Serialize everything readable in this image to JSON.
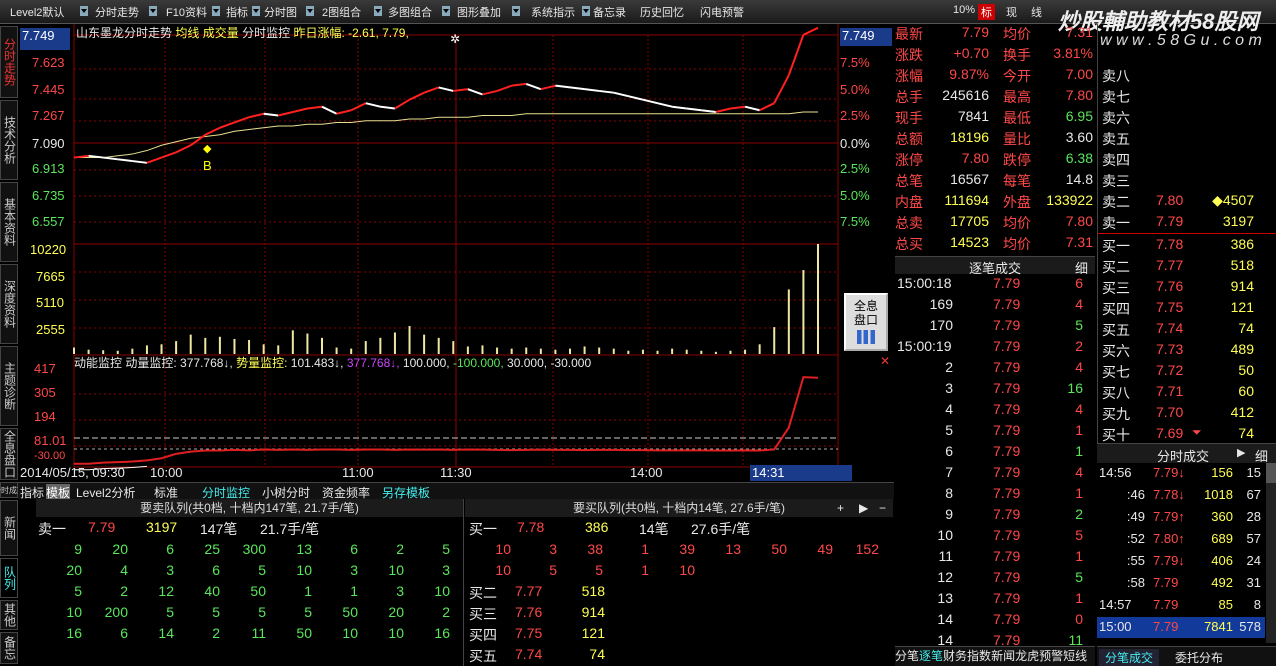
{
  "menu": [
    "Level2默认",
    "分时走势",
    "F10资料",
    "指标",
    "分时图",
    "2图组合",
    "多图组合",
    "图形叠加",
    "系统指示",
    "备忘录",
    "历史回忆",
    "闪电预警"
  ],
  "menu_right": {
    "pct": "10%",
    "biao": "标",
    "xian": "现",
    "line": "线"
  },
  "watermark": {
    "main": "炒股輔助教材58股网",
    "url": "w w w . 5 8 G u . c o m"
  },
  "sidetabs": [
    "分时走势",
    "技术分析",
    "基本资料",
    "深度资料",
    "主题诊断",
    "全息盘口"
  ],
  "sidetabs2": [
    "分时成交",
    "队列",
    "其他",
    "备忘"
  ],
  "news_tab": "新闻",
  "chart_header": {
    "name": "山东墨龙分时走势",
    "ma": "均线",
    "vol": "成交量",
    "monitor": "分时监控",
    "prev": "昨日涨幅: -2.61, 7.79,"
  },
  "price_axis": {
    "left": [
      "7.749",
      "7.623",
      "7.445",
      "7.267",
      "7.090",
      "6.913",
      "6.735",
      "6.557"
    ],
    "right": [
      "7.749",
      "7.5%",
      "5.0%",
      "2.5%",
      "0.0%",
      "2.5%",
      "5.0%",
      "7.5%"
    ]
  },
  "vol_axis": [
    "10220",
    "7665",
    "5110",
    "2555"
  ],
  "ind_axis": [
    "417",
    "305",
    "194",
    "81.01",
    "-30.00"
  ],
  "marker": "B",
  "quan": [
    "全息",
    "盘口"
  ],
  "ind_header": {
    "a": "动能监控",
    "b": "动量监控:",
    "c": "377.768↓,",
    "d": "势量监控:",
    "e": "101.483↓,",
    "f": "377.768↓,",
    "g": "100.000,",
    "h": "-100.000,",
    "i": "30.000,",
    "j": "-30.000"
  },
  "time_axis": {
    "date": "2014/05/15, 09:30",
    "t1": "10:00",
    "t2": "11:00",
    "t3": "11:30",
    "t4": "14:00",
    "t5": "14:31"
  },
  "bottom_tabs": [
    "指标",
    "模板",
    "Level2分析",
    "标准",
    "分时监控",
    "小树分时",
    "资金频率",
    "另存模板"
  ],
  "sell_queue": {
    "title": "要卖队列(共0档, 十档内147笔, 21.7手/笔)",
    "label": "卖一",
    "price": "7.79",
    "vol": "3197",
    "count": "147笔",
    "avg": "21.7手/笔",
    "rows": [
      [
        "9",
        "20",
        "6",
        "25",
        "300",
        "13",
        "6",
        "2",
        "5"
      ],
      [
        "20",
        "4",
        "3",
        "6",
        "5",
        "10",
        "3",
        "10",
        "3"
      ],
      [
        "5",
        "2",
        "12",
        "40",
        "50",
        "1",
        "1",
        "3",
        "10"
      ],
      [
        "10",
        "200",
        "5",
        "5",
        "5",
        "5",
        "50",
        "20",
        "2"
      ],
      [
        "16",
        "6",
        "14",
        "2",
        "11",
        "50",
        "10",
        "10",
        "16"
      ]
    ]
  },
  "buy_queue": {
    "title": "要买队列(共0档, 十档内14笔, 27.6手/笔)",
    "label": "买一",
    "price": "7.78",
    "vol": "386",
    "count": "14笔",
    "avg": "27.6手/笔",
    "rows": [
      [
        "10",
        "3",
        "38",
        "1",
        "39",
        "13",
        "50",
        "49",
        "152"
      ],
      [
        "10",
        "5",
        "5",
        "1",
        "10"
      ]
    ],
    "levels": [
      [
        "买二",
        "7.77",
        "518"
      ],
      [
        "买三",
        "7.76",
        "914"
      ],
      [
        "买四",
        "7.75",
        "121"
      ],
      [
        "买五",
        "7.74",
        "74"
      ]
    ]
  },
  "stats": [
    [
      "最新",
      "7.79",
      "均价",
      "7.31"
    ],
    [
      "涨跌",
      "+0.70",
      "换手",
      "3.81%"
    ],
    [
      "涨幅",
      "9.87%",
      "今开",
      "7.00"
    ],
    [
      "总手",
      "245616",
      "最高",
      "7.80"
    ],
    [
      "现手",
      "7841",
      "最低",
      "6.95"
    ],
    [
      "总额",
      "18196",
      "量比",
      "3.60"
    ],
    [
      "涨停",
      "7.80",
      "跌停",
      "6.38"
    ],
    [
      "总笔",
      "16567",
      "每笔",
      "14.8"
    ],
    [
      "内盘",
      "111694",
      "外盘",
      "133922"
    ],
    [
      "总卖",
      "17705",
      "均价",
      "7.80"
    ],
    [
      "总买",
      "14523",
      "均价",
      "7.31"
    ]
  ],
  "asks": [
    [
      "卖八",
      "",
      ""
    ],
    [
      "卖七",
      "",
      ""
    ],
    [
      "卖六",
      "",
      ""
    ],
    [
      "卖五",
      "",
      ""
    ],
    [
      "卖四",
      "",
      ""
    ],
    [
      "卖三",
      "",
      ""
    ],
    [
      "卖二",
      "7.80",
      "4507"
    ],
    [
      "卖一",
      "7.79",
      "3197"
    ]
  ],
  "bids": [
    [
      "买一",
      "7.78",
      "386"
    ],
    [
      "买二",
      "7.77",
      "518"
    ],
    [
      "买三",
      "7.76",
      "914"
    ],
    [
      "买四",
      "7.75",
      "121"
    ],
    [
      "买五",
      "7.74",
      "74"
    ],
    [
      "买六",
      "7.73",
      "489"
    ],
    [
      "买七",
      "7.72",
      "50"
    ],
    [
      "买八",
      "7.71",
      "60"
    ],
    [
      "买九",
      "7.70",
      "412"
    ],
    [
      "买十",
      "7.69",
      "74"
    ]
  ],
  "tick_title": "逐笔成交",
  "tick_detail": "细",
  "ticks": [
    [
      "15:00:18",
      "7.79",
      "6"
    ],
    [
      "169",
      "7.79",
      "4"
    ],
    [
      "170",
      "7.79",
      "5"
    ],
    [
      "15:00:19",
      "7.79",
      "2"
    ],
    [
      "2",
      "7.79",
      "4"
    ],
    [
      "3",
      "7.79",
      "16"
    ],
    [
      "4",
      "7.79",
      "4"
    ],
    [
      "5",
      "7.79",
      "1"
    ],
    [
      "6",
      "7.79",
      "1"
    ],
    [
      "7",
      "7.79",
      "4"
    ],
    [
      "8",
      "7.79",
      "1"
    ],
    [
      "9",
      "7.79",
      "2"
    ],
    [
      "10",
      "7.79",
      "5"
    ],
    [
      "11",
      "7.79",
      "1"
    ],
    [
      "12",
      "7.79",
      "5"
    ],
    [
      "13",
      "7.79",
      "1"
    ],
    [
      "14",
      "7.79",
      "0"
    ],
    [
      "14",
      "7.79",
      "11"
    ]
  ],
  "fs_title": "分时成交",
  "fs_detail": "细",
  "fs_rows": [
    [
      "14:56",
      "7.79",
      "↓",
      "156",
      "15"
    ],
    [
      ":46",
      "7.78",
      "↓",
      "1018",
      "67"
    ],
    [
      ":49",
      "7.79",
      "↑",
      "360",
      "28"
    ],
    [
      ":52",
      "7.80",
      "↑",
      "689",
      "57"
    ],
    [
      ":55",
      "7.79",
      "↓",
      "406",
      "24"
    ],
    [
      ":58",
      "7.79",
      "",
      "492",
      "31"
    ],
    [
      "14:57",
      "7.79",
      "",
      "85",
      "8"
    ],
    [
      "15:00",
      "7.79",
      "",
      "7841",
      "578"
    ]
  ],
  "bottom_bar": {
    "a": "分笔",
    "b": "逐笔",
    "c": "财务",
    "d": "指数",
    "e": "新闻",
    "f": "龙虎",
    "g": "预警",
    "h": "短线",
    "i": "分笔成交",
    "j": "委托分布"
  },
  "chart_data": {
    "type": "line",
    "title": "山东墨龙分时走势",
    "ylim": [
      6.557,
      7.749
    ],
    "prev_close": 7.09,
    "price": [
      7.05,
      7.06,
      7.05,
      7.04,
      7.03,
      7.02,
      7.05,
      7.08,
      7.12,
      7.18,
      7.22,
      7.25,
      7.28,
      7.3,
      7.29,
      7.31,
      7.33,
      7.34,
      7.3,
      7.32,
      7.36,
      7.34,
      7.33,
      7.38,
      7.42,
      7.45,
      7.43,
      7.44,
      7.41,
      7.43,
      7.46,
      7.47,
      7.44,
      7.46,
      7.45,
      7.44,
      7.43,
      7.42,
      7.4,
      7.38,
      7.36,
      7.34,
      7.33,
      7.32,
      7.31,
      7.33,
      7.34,
      7.32,
      7.36,
      7.52,
      7.75,
      7.79
    ],
    "avg": [
      7.05,
      7.05,
      7.05,
      7.06,
      7.07,
      7.09,
      7.12,
      7.14,
      7.16,
      7.17,
      7.18,
      7.2,
      7.21,
      7.22,
      7.23,
      7.23,
      7.24,
      7.24,
      7.25,
      7.25,
      7.26,
      7.26,
      7.26,
      7.27,
      7.27,
      7.28,
      7.28,
      7.28,
      7.29,
      7.29,
      7.29,
      7.3,
      7.3,
      7.3,
      7.3,
      7.3,
      7.3,
      7.3,
      7.3,
      7.3,
      7.3,
      7.3,
      7.3,
      7.3,
      7.3,
      7.3,
      7.3,
      7.3,
      7.3,
      7.3,
      7.31,
      7.31
    ],
    "volume": [
      600,
      400,
      350,
      300,
      500,
      800,
      900,
      1200,
      1800,
      1500,
      1600,
      1400,
      1300,
      900,
      800,
      2200,
      1900,
      1500,
      600,
      500,
      1200,
      1500,
      2000,
      2600,
      1800,
      1500,
      1200,
      700,
      800,
      600,
      500,
      600,
      500,
      400,
      500,
      700,
      600,
      500,
      300,
      400,
      300,
      500,
      400,
      300,
      200,
      300,
      400,
      900,
      2500,
      6000,
      7800,
      10220
    ],
    "indicator": [
      -15,
      -15,
      -10,
      -8,
      -5,
      0,
      10,
      30,
      40,
      45,
      45,
      48,
      46,
      50,
      48,
      50,
      48,
      50,
      50,
      48,
      50,
      50,
      48,
      50,
      49,
      50,
      48,
      50,
      49,
      48,
      47,
      48,
      49,
      48,
      48,
      47,
      48,
      48,
      47,
      47,
      46,
      46,
      46,
      46,
      45,
      45,
      46,
      45,
      50,
      150,
      380,
      377
    ]
  }
}
